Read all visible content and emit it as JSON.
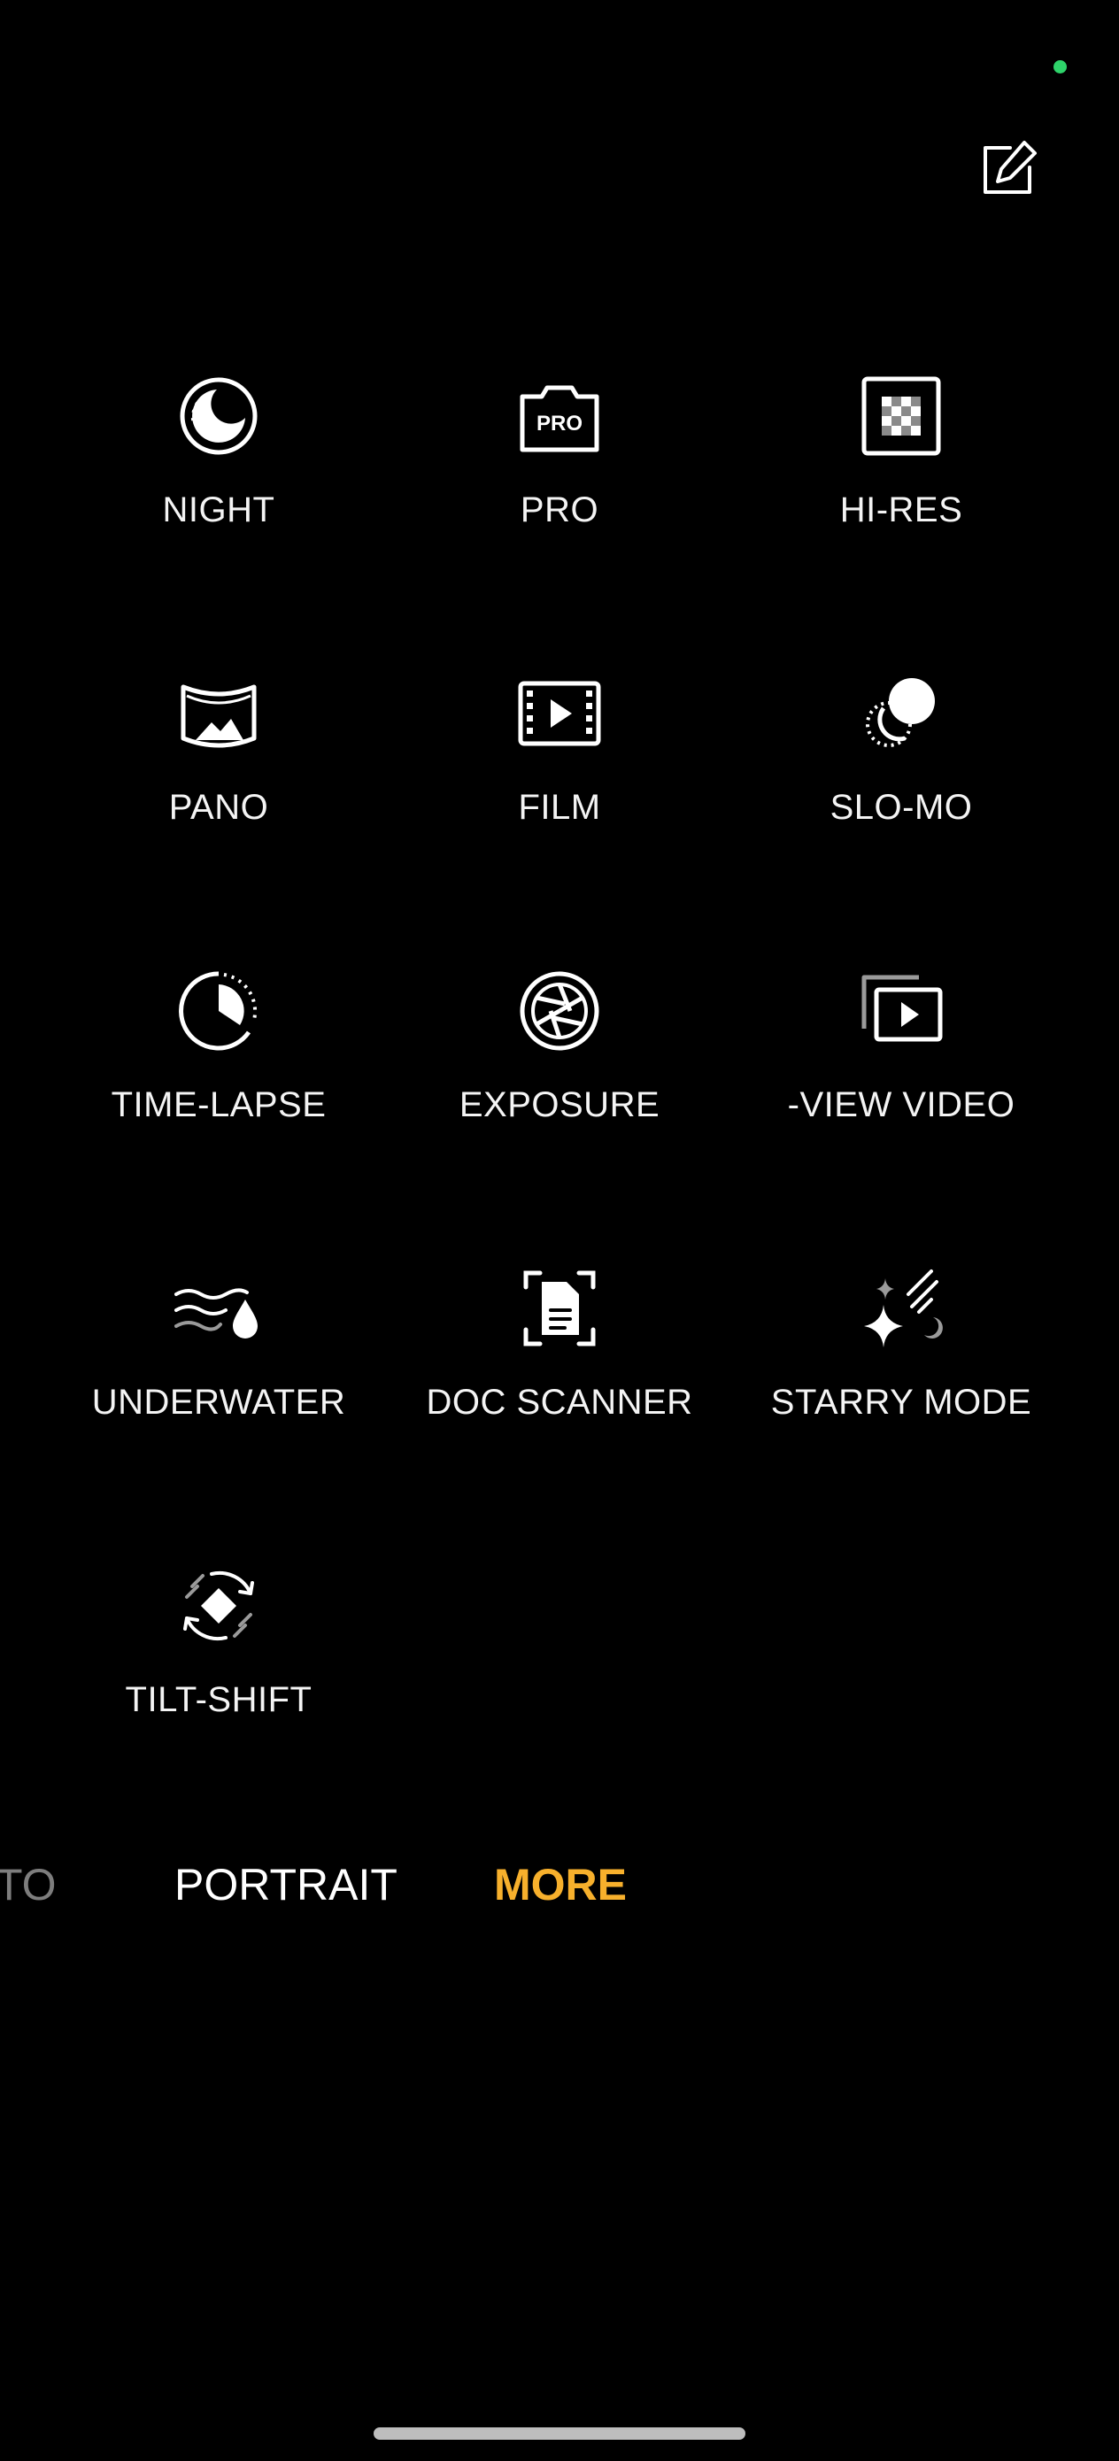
{
  "colors": {
    "accent": "#f7b02c",
    "status_dot": "#2ed36a",
    "background": "#000000"
  },
  "header": {
    "edit_icon": "edit-icon"
  },
  "modes": [
    {
      "label": "NIGHT",
      "icon": "night-moon-icon"
    },
    {
      "label": "PRO",
      "icon": "pro-camera-icon"
    },
    {
      "label": "HI-RES",
      "icon": "hi-res-grid-icon"
    },
    {
      "label": "PANO",
      "icon": "pano-icon"
    },
    {
      "label": "FILM",
      "icon": "film-icon"
    },
    {
      "label": "SLO-MO",
      "icon": "slo-mo-icon"
    },
    {
      "label": "TIME-LAPSE",
      "icon": "time-lapse-icon"
    },
    {
      "label": "EXPOSURE",
      "icon": "exposure-aperture-icon"
    },
    {
      "label": "-VIEW VIDEO",
      "icon": "dual-view-video-icon"
    },
    {
      "label": "UNDERWATER",
      "icon": "underwater-icon"
    },
    {
      "label": "DOC SCANNER",
      "icon": "doc-scanner-icon"
    },
    {
      "label": "STARRY MODE",
      "icon": "starry-mode-icon"
    },
    {
      "label": "TILT-SHIFT",
      "icon": "tilt-shift-icon"
    }
  ],
  "tabs": {
    "photo": "TO",
    "portrait": "PORTRAIT",
    "more": "MORE"
  }
}
